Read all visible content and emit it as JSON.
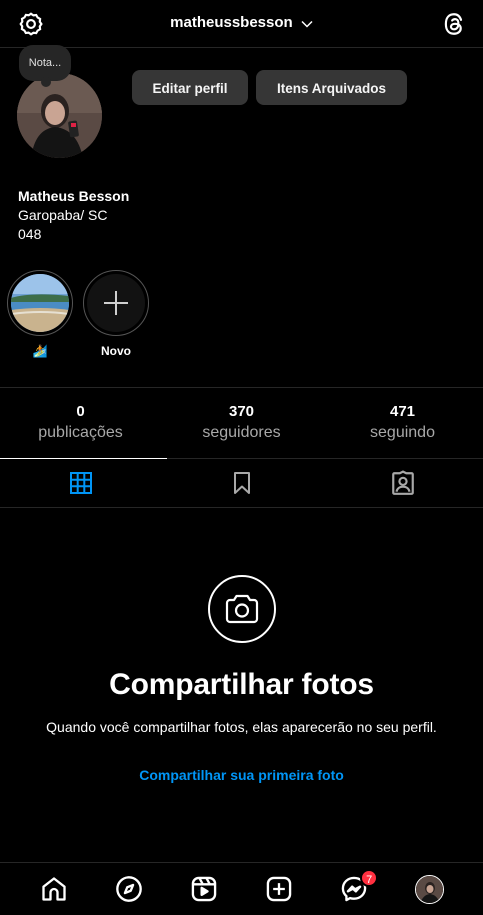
{
  "header": {
    "username": "matheussbesson"
  },
  "note": {
    "label": "Nota..."
  },
  "buttons": {
    "edit_profile": "Editar perfil",
    "archived_items": "Itens Arquivados"
  },
  "bio": {
    "name": "Matheus Besson",
    "location": "Garopaba/ SC",
    "code": "048"
  },
  "highlights": [
    {
      "label": "🏄",
      "icon": "beach-photo"
    },
    {
      "label": "Novo",
      "icon": "plus-icon"
    }
  ],
  "stats": [
    {
      "value": "0",
      "label": "publicações"
    },
    {
      "value": "370",
      "label": "seguidores"
    },
    {
      "value": "471",
      "label": "seguindo"
    }
  ],
  "tabs": [
    {
      "icon": "grid-icon",
      "active": true
    },
    {
      "icon": "bookmark-icon",
      "active": false
    },
    {
      "icon": "tagged-icon",
      "active": false
    }
  ],
  "empty_state": {
    "title": "Compartilhar fotos",
    "description": "Quando você compartilhar fotos, elas aparecerão no seu perfil.",
    "link": "Compartilhar sua primeira foto"
  },
  "bottom_nav": {
    "items": [
      "home-icon",
      "explore-icon",
      "reels-icon",
      "create-icon",
      "messenger-icon",
      "profile-avatar"
    ],
    "messenger_badge": "7"
  },
  "colors": {
    "background": "#000000",
    "link": "#0095f6",
    "badge": "#ff3040",
    "active_tab": "#0095f6"
  }
}
